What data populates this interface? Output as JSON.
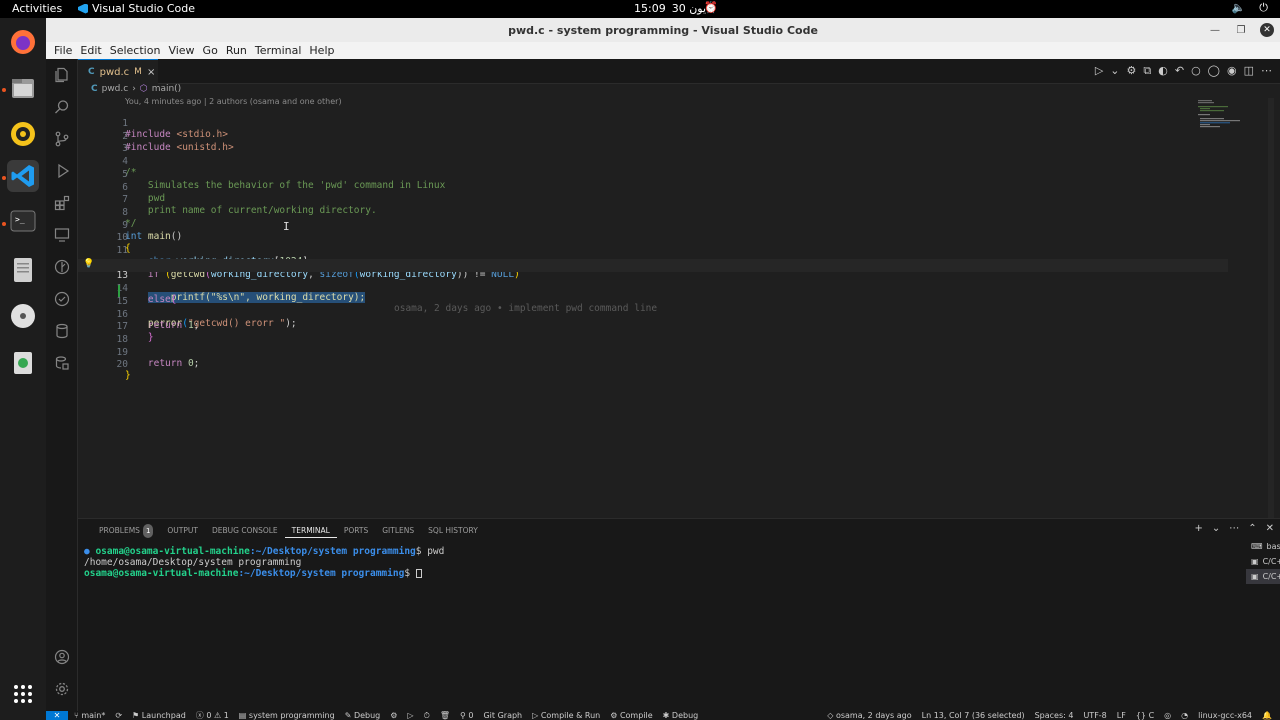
{
  "topbar": {
    "activities": "Activities",
    "app_name": "Visual Studio Code",
    "time": "15:09",
    "date": "يون 30"
  },
  "window": {
    "title": "pwd.c - system programming - Visual Studio Code"
  },
  "menu": [
    "File",
    "Edit",
    "Selection",
    "View",
    "Go",
    "Run",
    "Terminal",
    "Help"
  ],
  "tab": {
    "lang": "C",
    "name": "pwd.c",
    "modified": "M",
    "close": "×"
  },
  "breadcrumb": {
    "file": "pwd.c",
    "sep": "›",
    "symbol": "main()"
  },
  "blame_header": "You, 4 minutes ago | 2 authors (osama and one other)",
  "code": {
    "line_numbers": [
      "1",
      "2",
      "3",
      "4",
      "5",
      "6",
      "7",
      "8",
      "9",
      "10",
      "11",
      "12",
      "13",
      "14",
      "15",
      "16",
      "17",
      "18",
      "19",
      "20"
    ],
    "current_line": 13,
    "l1": {
      "a": "#include",
      "b": " <stdio.h>"
    },
    "l2": {
      "a": "#include",
      "b": " <unistd.h>"
    },
    "l4": "/*",
    "l5": "    Simulates the behavior of the 'pwd' command in Linux",
    "l6": "    pwd",
    "l7": "    print name of current/working directory.",
    "l8": "*/",
    "l9": {
      "kw": "int",
      "fn": " main",
      "rest": "()"
    },
    "l10": "{",
    "l11": {
      "indent": "    ",
      "kw": "char",
      "var": " working_directory",
      "a": "[",
      "num": "1024",
      "b": "];"
    },
    "l12": {
      "indent": "    ",
      "kw": "if",
      "a": " (",
      "fn": "getcwd",
      "b": "(",
      "var": "working_directory",
      "c": ", ",
      "kw2": "sizeof",
      "d": "(",
      "var2": "working_directory",
      "e": ")) != ",
      "kw3": "NULL",
      "f": ")"
    },
    "l13": {
      "indent": "    ",
      "sel": "    printf(\"%s\\n\", working_directory);",
      "blame": "osama, 2 days ago • implement pwd command line"
    },
    "l14": {
      "indent": "    ",
      "kw": "else",
      "a": "{"
    },
    "l15": {
      "indent": "    ",
      "fn": "perror",
      "a": "(",
      "str": "\"getcwd() erorr \"",
      "b": ");"
    },
    "l16": {
      "indent": "    ",
      "kw": "return",
      "num": " 1",
      "a": ";"
    },
    "l17": {
      "indent": "    ",
      "a": "}"
    },
    "l19": {
      "indent": "    ",
      "kw": "return",
      "num": " 0",
      "a": ";"
    },
    "l20": "}"
  },
  "panel": {
    "tabs": [
      "PROBLEMS",
      "OUTPUT",
      "DEBUG CONSOLE",
      "TERMINAL",
      "PORTS",
      "GITLENS",
      "SQL HISTORY"
    ],
    "problems_count": "1",
    "active_tab": "TERMINAL",
    "terminal": {
      "prompt_user": "osama@osama-virtual-machine",
      "prompt_path": ":~/Desktop/system programming",
      "cmd1": "$ pwd",
      "output1": "/home/osama/Desktop/system programming",
      "cmd2": "$ "
    },
    "terminal_list": [
      {
        "label": "bash"
      },
      {
        "label": "C/C++ ..."
      },
      {
        "label": "C/C++ Com..."
      }
    ]
  },
  "statusbar": {
    "remote": "✕",
    "branch": "main*",
    "launchpad": "Launchpad",
    "errors": "0",
    "warnings": "1",
    "folder": "system programming",
    "debug": "Debug",
    "ports": "0",
    "git_graph": "Git Graph",
    "compile_run": "Compile & Run",
    "compile": "Compile",
    "debug2": "Debug",
    "blame": "osama, 2 days ago",
    "position": "Ln 13, Col 7 (36 selected)",
    "spaces": "Spaces: 4",
    "encoding": "UTF-8",
    "eol": "LF",
    "language": "C",
    "config": "linux-gcc-x64"
  },
  "colors": {
    "accent": "#0078d4",
    "editor_bg": "#1f1f1f",
    "selection": "#264f78",
    "prompt_green": "#23d18b",
    "prompt_blue": "#3b8eea"
  }
}
